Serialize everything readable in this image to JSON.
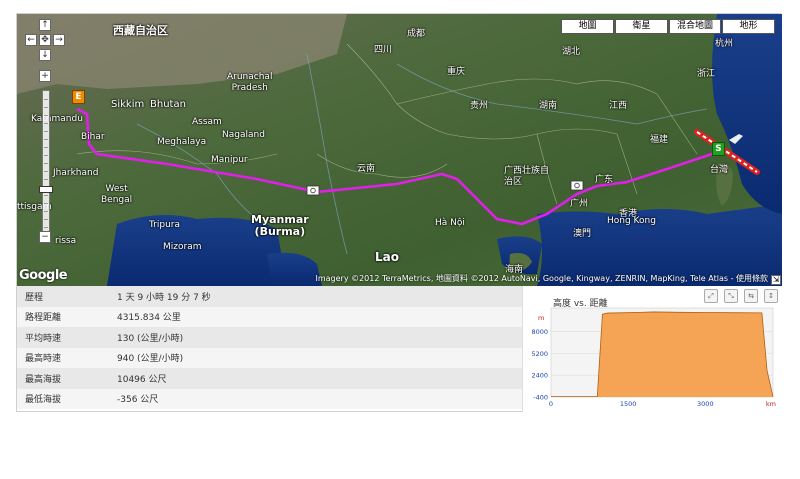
{
  "map": {
    "type_buttons": [
      "地圖",
      "衛星",
      "混合地圖",
      "地形"
    ],
    "labels": {
      "xizang": "西藏自治区",
      "sichuan": "四川",
      "chengdu": "成都",
      "chongqing": "重庆",
      "guizhou": "贵州",
      "hunan": "湖南",
      "hubei": "湖北",
      "jiangxi": "江西",
      "zhejiang": "浙江",
      "fujian": "福建",
      "guangdong": "广东",
      "guangxi": "广西壮族自治区",
      "yunnan": "云南",
      "taiwan": "台灣",
      "hongkong_zh": "香港",
      "hongkong_en": "Hong Kong",
      "macau": "澳門",
      "guangzhou": "广州",
      "hangzhou": "杭州",
      "hanoi": "Hà Nội",
      "hainan": "海南",
      "lao": "Lao",
      "myanmar": "Myanmar\n(Burma)",
      "nepal_capital": "Kathmandu",
      "sikkim": "Sikkim",
      "bhutan": "Bhutan",
      "arunachal": "Arunachal\nPradesh",
      "assam": "Assam",
      "meghalaya": "Meghalaya",
      "nagaland": "Nagaland",
      "manipur": "Manipur",
      "bihar": "Bihar",
      "jharkhand": "Jharkhand",
      "west_bengal": "West\nBengal",
      "tripura": "Tripura",
      "mizoram": "Mizoram",
      "chhattisgarh": "ttisgarh",
      "orissa": "rissa"
    },
    "attribution": "Imagery ©2012 TerraMetrics, 地圖資料 ©2012 AutoNavi, Google, Kingway, ZENRIN, MapKing, Tele Atlas - 使用條款",
    "logo": "Google",
    "markers": {
      "start": "S",
      "end": "E"
    },
    "nav": {
      "up": "↑",
      "down": "↓",
      "left": "←",
      "right": "→",
      "center": "✥",
      "zoom_in": "+",
      "zoom_out": "−"
    },
    "route_color": "#e020e8"
  },
  "stats": [
    {
      "label": "歷程",
      "value": "1 天 9 小時 19 分 7 秒"
    },
    {
      "label": "路程距離",
      "value": "4315.834 公里"
    },
    {
      "label": "平均時速",
      "value": "130 (公里/小時)"
    },
    {
      "label": "最高時速",
      "value": "940 (公里/小時)"
    },
    {
      "label": "最高海拔",
      "value": "10496 公尺"
    },
    {
      "label": "最低海拔",
      "value": "-356 公尺"
    }
  ],
  "chart_data": {
    "type": "area",
    "title": "高度 vs. 距離",
    "ylabel": "m",
    "xlabel": "km",
    "yticks": [
      -400,
      2400,
      5200,
      8000
    ],
    "xticks": [
      0,
      1500,
      3000
    ],
    "ylim": [
      -400,
      11000
    ],
    "xlim": [
      0,
      4316
    ],
    "x": [
      0,
      900,
      1000,
      1100,
      1500,
      2000,
      2500,
      3000,
      3500,
      4100,
      4200,
      4316
    ],
    "y": [
      -356,
      -356,
      10200,
      10350,
      10400,
      10496,
      10450,
      10420,
      10400,
      10380,
      3000,
      -356
    ],
    "fill_color": "#f5a456",
    "line_color": "#b06010",
    "tools": [
      "⤢",
      "⤡",
      "⇆",
      "↕"
    ]
  }
}
